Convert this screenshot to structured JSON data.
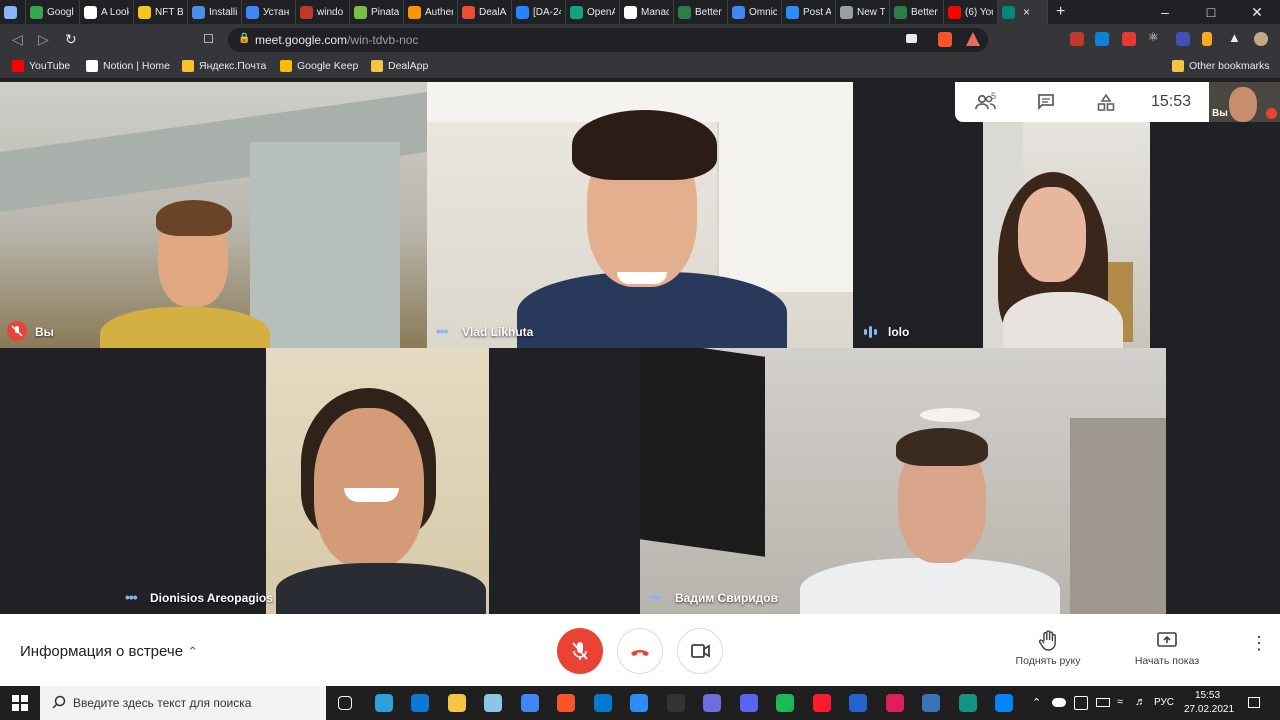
{
  "browser": {
    "tabs": [
      {
        "title": "",
        "color": "#8ab4f8"
      },
      {
        "title": "Googl",
        "color": "#34a853"
      },
      {
        "title": "A Look",
        "color": "#ffffff"
      },
      {
        "title": "NFT Bi",
        "color": "#f5c518"
      },
      {
        "title": "Installi",
        "color": "#4a8fe7"
      },
      {
        "title": "Устан",
        "color": "#4285f4"
      },
      {
        "title": "windo",
        "color": "#c0392b"
      },
      {
        "title": "Pinata",
        "color": "#7ac143"
      },
      {
        "title": "Auther",
        "color": "#ff9800"
      },
      {
        "title": "DealAp",
        "color": "#e94f37"
      },
      {
        "title": "[DA-24",
        "color": "#2684ff"
      },
      {
        "title": "OpenA",
        "color": "#10a37f"
      },
      {
        "title": "Manac",
        "color": "#ffffff"
      },
      {
        "title": "Better",
        "color": "#2d7d46"
      },
      {
        "title": "Omnic",
        "color": "#4285f4"
      },
      {
        "title": "Post A",
        "color": "#2d8cff"
      },
      {
        "title": "New Tab",
        "color": "#9aa0a6"
      },
      {
        "title": "Better",
        "color": "#2d7d46"
      },
      {
        "title": "(6) You",
        "color": "#ff0000"
      },
      {
        "title": "",
        "color": "#00897b",
        "active": true
      }
    ],
    "new_tab_symbol": "+",
    "url_host": "meet.google.com",
    "url_path": "/win-tdvb-noc",
    "bookmarks": [
      {
        "label": "YouTube",
        "color": "#ff0000"
      },
      {
        "label": "Notion | Home",
        "color": "#ffffff"
      },
      {
        "label": "Яндекс.Почта",
        "color": "#f9c22e"
      },
      {
        "label": "Google Keep",
        "color": "#fbbc04"
      },
      {
        "label": "DealApp",
        "color": "#f6c344"
      }
    ],
    "other_bookmarks": "Other bookmarks",
    "extension_badges": {
      "ext1": "2",
      "ext2": "9+"
    }
  },
  "meet": {
    "info_card": {
      "participants_count": "5",
      "time": "15:53"
    },
    "self_mini_label": "Вы",
    "participants": [
      {
        "name": "Вы",
        "muted": true
      },
      {
        "name": "Vlad Likhuta",
        "muted": false
      },
      {
        "name": "lolo",
        "muted": false,
        "speaking": true
      },
      {
        "name": "Dionisios Areopagios",
        "muted": false
      },
      {
        "name": "Вадим Свиридов",
        "muted": false
      }
    ],
    "controls": {
      "meeting_info": "Информация о встрече",
      "raise_hand": "Поднять руку",
      "present": "Начать показ"
    },
    "colors": {
      "end_call": "#ea4335",
      "mic_off": "#ea4335",
      "speaking_dots": "#8ab4f8"
    }
  },
  "taskbar": {
    "search_placeholder": "Введите здесь текст для поиска",
    "language": "РУС",
    "time": "15:53",
    "date": "27.02.2021",
    "icons": [
      {
        "name": "task-view",
        "color": "#ffffff"
      },
      {
        "name": "telegram",
        "color": "#2aa1da"
      },
      {
        "name": "mail",
        "color": "#0f78d4"
      },
      {
        "name": "file-explorer",
        "color": "#f4c542"
      },
      {
        "name": "paint",
        "color": "#8cc6e7"
      },
      {
        "name": "chrome",
        "color": "#4285f4"
      },
      {
        "name": "brave",
        "color": "#fb542b"
      },
      {
        "name": "vscode",
        "color": "#007acc"
      },
      {
        "name": "zoom",
        "color": "#2d8cff"
      },
      {
        "name": "terminal",
        "color": "#333333"
      },
      {
        "name": "settings",
        "color": "#6d6ddb"
      },
      {
        "name": "discord",
        "color": "#5865f2"
      },
      {
        "name": "spotify",
        "color": "#1db954"
      },
      {
        "name": "opera",
        "color": "#ff1b2d"
      },
      {
        "name": "todo",
        "color": "#2564cf"
      },
      {
        "name": "slack",
        "color": "#e01e5a"
      },
      {
        "name": "qbittorrent",
        "color": "#3b73b9"
      },
      {
        "name": "gitkraken",
        "color": "#179287"
      },
      {
        "name": "messenger",
        "color": "#0084ff"
      }
    ]
  }
}
